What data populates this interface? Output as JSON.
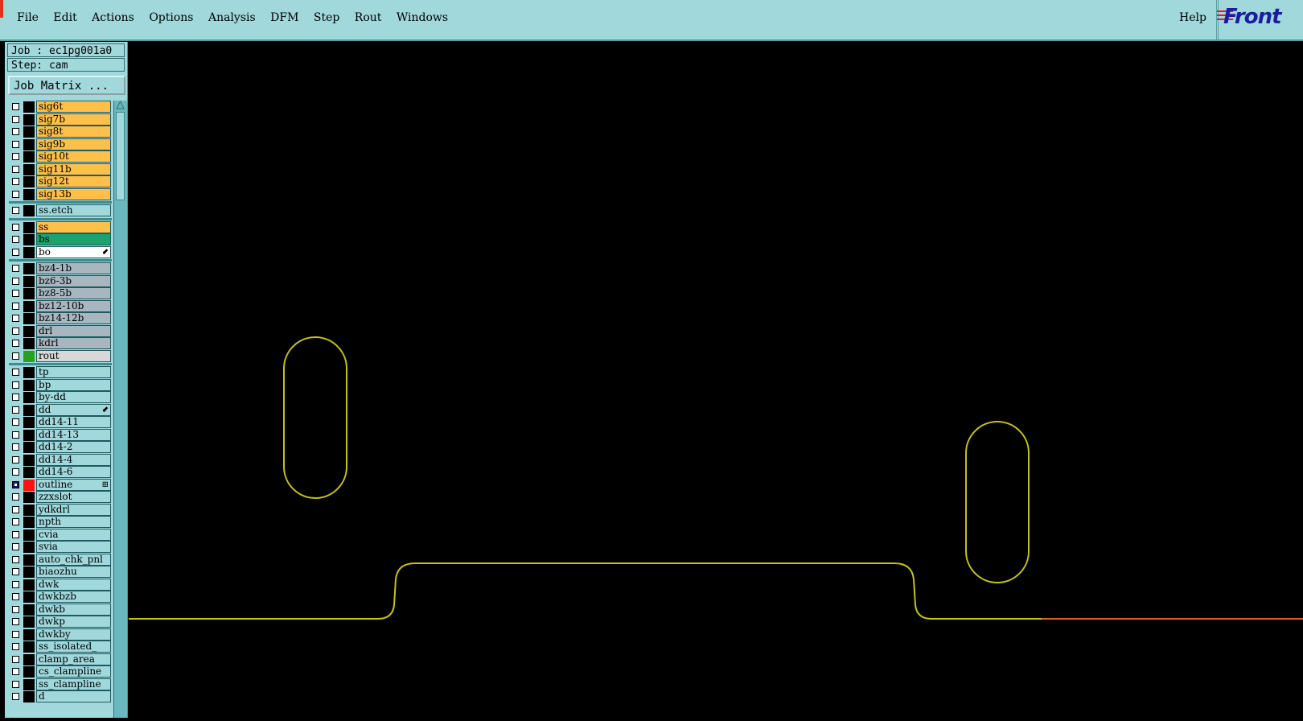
{
  "menubar": {
    "items": [
      "File",
      "Edit",
      "Actions",
      "Options",
      "Analysis",
      "DFM",
      "Step",
      "Rout",
      "Windows"
    ],
    "help": "Help",
    "logo": "Front"
  },
  "info": {
    "job": "Job : ec1pg001a0",
    "step": "Step: cam",
    "matrix_button": "Job Matrix ..."
  },
  "colors": {
    "signal": "#ffc04a",
    "solder_green": "#1aa36a",
    "board_gray": "#a8b6c0",
    "drill_teal": "#a0d8dc",
    "rout_gray": "#d8d8d8",
    "outline_red": "#ff1010",
    "rout_swatch": "#28a020",
    "profile_line": "#c5c21a",
    "orange_line": "#e06010"
  },
  "layers": [
    {
      "name": "sig6t",
      "bg": "#ffc04a"
    },
    {
      "name": "sig7b",
      "bg": "#ffc04a"
    },
    {
      "name": "sig8t",
      "bg": "#ffc04a"
    },
    {
      "name": "sig9b",
      "bg": "#ffc04a"
    },
    {
      "name": "sig10t",
      "bg": "#ffc04a"
    },
    {
      "name": "sig11b",
      "bg": "#ffc04a"
    },
    {
      "name": "sig12t",
      "bg": "#ffc04a"
    },
    {
      "name": "sig13b",
      "bg": "#ffc04a"
    },
    {
      "sep": true
    },
    {
      "name": "ss.etch",
      "bg": "#a0d8dc"
    },
    {
      "sep": true
    },
    {
      "name": "ss",
      "bg": "#ffc04a"
    },
    {
      "name": "bs",
      "bg": "#1aa36a"
    },
    {
      "name": "bo",
      "bg": "#ffffff",
      "mark": "⬋"
    },
    {
      "sep": true
    },
    {
      "name": "bz4-1b",
      "bg": "#a8b6c0"
    },
    {
      "name": "bz6-3b",
      "bg": "#a8b6c0"
    },
    {
      "name": "bz8-5b",
      "bg": "#a8b6c0"
    },
    {
      "name": "bz12-10b",
      "bg": "#a8b6c0"
    },
    {
      "name": "bz14-12b",
      "bg": "#a8b6c0"
    },
    {
      "name": "drl",
      "bg": "#a8b6c0"
    },
    {
      "name": "kdrl",
      "bg": "#a8b6c0"
    },
    {
      "name": "rout",
      "bg": "#d8d8d8",
      "swatch": "#28a020"
    },
    {
      "sep": true
    },
    {
      "name": "tp",
      "bg": "#a0d8dc"
    },
    {
      "name": "bp",
      "bg": "#a0d8dc"
    },
    {
      "name": "by-dd",
      "bg": "#a0d8dc"
    },
    {
      "name": "dd",
      "bg": "#a0d8dc",
      "mark": "⬋"
    },
    {
      "name": "dd14-11",
      "bg": "#a0d8dc"
    },
    {
      "name": "dd14-13",
      "bg": "#a0d8dc"
    },
    {
      "name": "dd14-2",
      "bg": "#a0d8dc"
    },
    {
      "name": "dd14-4",
      "bg": "#a0d8dc"
    },
    {
      "name": "dd14-6",
      "bg": "#a0d8dc"
    },
    {
      "name": "outline",
      "bg": "#a0d8dc",
      "swatch": "#ff1010",
      "checked": true,
      "mark": "⊞"
    },
    {
      "name": "zzxslot",
      "bg": "#a0d8dc"
    },
    {
      "name": "ydkdrl",
      "bg": "#a0d8dc"
    },
    {
      "name": "npth",
      "bg": "#a0d8dc"
    },
    {
      "name": "cvia",
      "bg": "#a0d8dc"
    },
    {
      "name": "svia",
      "bg": "#a0d8dc"
    },
    {
      "name": "auto_chk_pnl",
      "bg": "#a0d8dc"
    },
    {
      "name": "biaozhu",
      "bg": "#a0d8dc"
    },
    {
      "name": "dwk",
      "bg": "#a0d8dc"
    },
    {
      "name": "dwkbzb",
      "bg": "#a0d8dc"
    },
    {
      "name": "dwkb",
      "bg": "#a0d8dc"
    },
    {
      "name": "dwkp",
      "bg": "#a0d8dc"
    },
    {
      "name": "dwkby",
      "bg": "#a0d8dc"
    },
    {
      "name": "ss_isolated_",
      "bg": "#a0d8dc"
    },
    {
      "name": "clamp_area",
      "bg": "#a0d8dc"
    },
    {
      "name": "cs_clampline",
      "bg": "#a0d8dc"
    },
    {
      "name": "ss_clampline",
      "bg": "#a0d8dc"
    },
    {
      "name": "d",
      "bg": "#a0d8dc"
    }
  ]
}
